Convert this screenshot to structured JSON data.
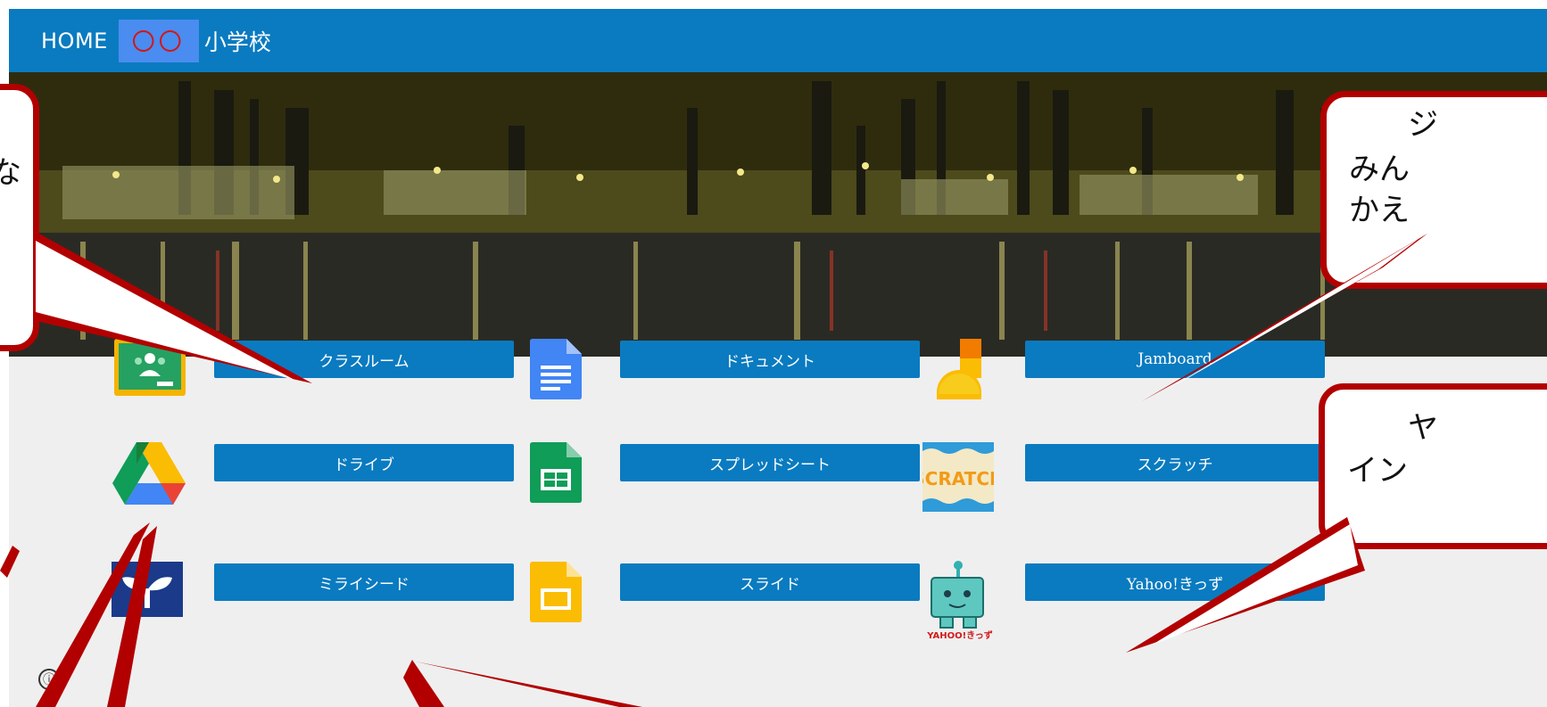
{
  "header": {
    "home_label": "HOME",
    "school_mark": "〇〇",
    "school_name": "小学校"
  },
  "colors": {
    "header_bg": "#0a7bc0",
    "button_bg": "#0a7bc0",
    "callout_border": "#b20000",
    "page_bg": "#efefef"
  },
  "apps": [
    {
      "icon": "google-classroom-icon",
      "label": "クラスルーム"
    },
    {
      "icon": "google-docs-icon",
      "label": "ドキュメント"
    },
    {
      "icon": "jamboard-icon",
      "label": "Jamboard"
    },
    {
      "icon": "google-drive-icon",
      "label": "ドライブ"
    },
    {
      "icon": "google-sheets-icon",
      "label": "スプレッドシート"
    },
    {
      "icon": "scratch-icon",
      "label": "スクラッチ"
    },
    {
      "icon": "mirai-seed-icon",
      "label": "ミライシード"
    },
    {
      "icon": "google-slides-icon",
      "label": "スライド"
    },
    {
      "icon": "yahoo-kids-icon",
      "label": "Yahoo!きっず"
    }
  ],
  "scratch_logo_text": "SCRATCH",
  "yahoo_logo_text": "YAHOO!きっず",
  "callouts": {
    "right_top_lines": [
      "ジ",
      "みん",
      "かえ"
    ],
    "right_mid_lines": [
      "ヤ",
      "イン"
    ],
    "left_top_line": "な"
  },
  "info_icon": "ⓘ"
}
